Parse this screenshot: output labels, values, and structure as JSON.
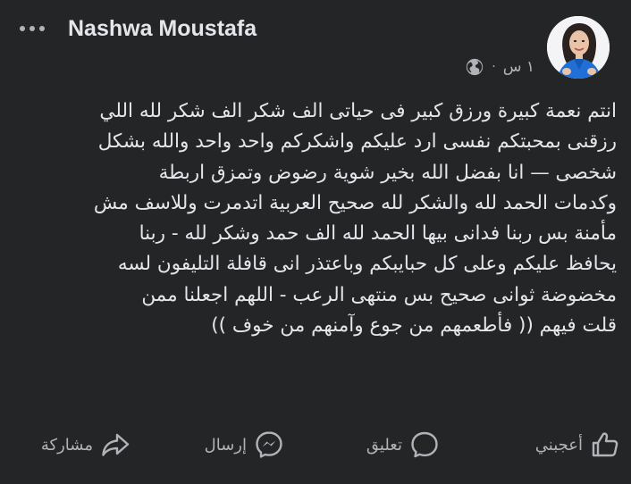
{
  "post": {
    "author": "Nashwa Moustafa",
    "time": "١ س",
    "separator": "·",
    "text_lines": [
      "انتم نعمة كبيرة ورزق كبير فى حياتى الف شكر الف شكر لله اللي",
      "رزقنى بمحبتكم نفسى ارد عليكم واشكركم واحد واحد والله بشكل",
      "شخصى —  انا بفضل الله بخير شوية رضوض وتمزق اربطة",
      "وكدمات الحمد لله والشكر لله صحيح العربية اتدمرت وللاسف مش",
      "مأمنة بس ربنا فدانى بيها الحمد لله الف حمد وشكر  لله - ربنا",
      "يحافظ عليكم وعلى كل حبايبكم وباعتذر انى قافلة التليفون لسه",
      "مخضوضة ثوانى صحيح بس منتهى الرعب -  اللهم اجعلنا ممن",
      "قلت فيهم (( فأطعمهم من جوع وآمنهم من خوف ))"
    ]
  },
  "actions": {
    "like": "أعجبني",
    "comment": "تعليق",
    "send": "إرسال",
    "share": "مشاركة"
  },
  "icons": {
    "more": "more-horizontal-icon",
    "audience": "globe-icon",
    "like": "thumbs-up-icon",
    "comment": "comment-icon",
    "send": "messenger-icon",
    "share": "share-arrow-icon"
  },
  "colors": {
    "background": "#242526",
    "primary_text": "#e4e6eb",
    "secondary_text": "#b0b3b8"
  }
}
